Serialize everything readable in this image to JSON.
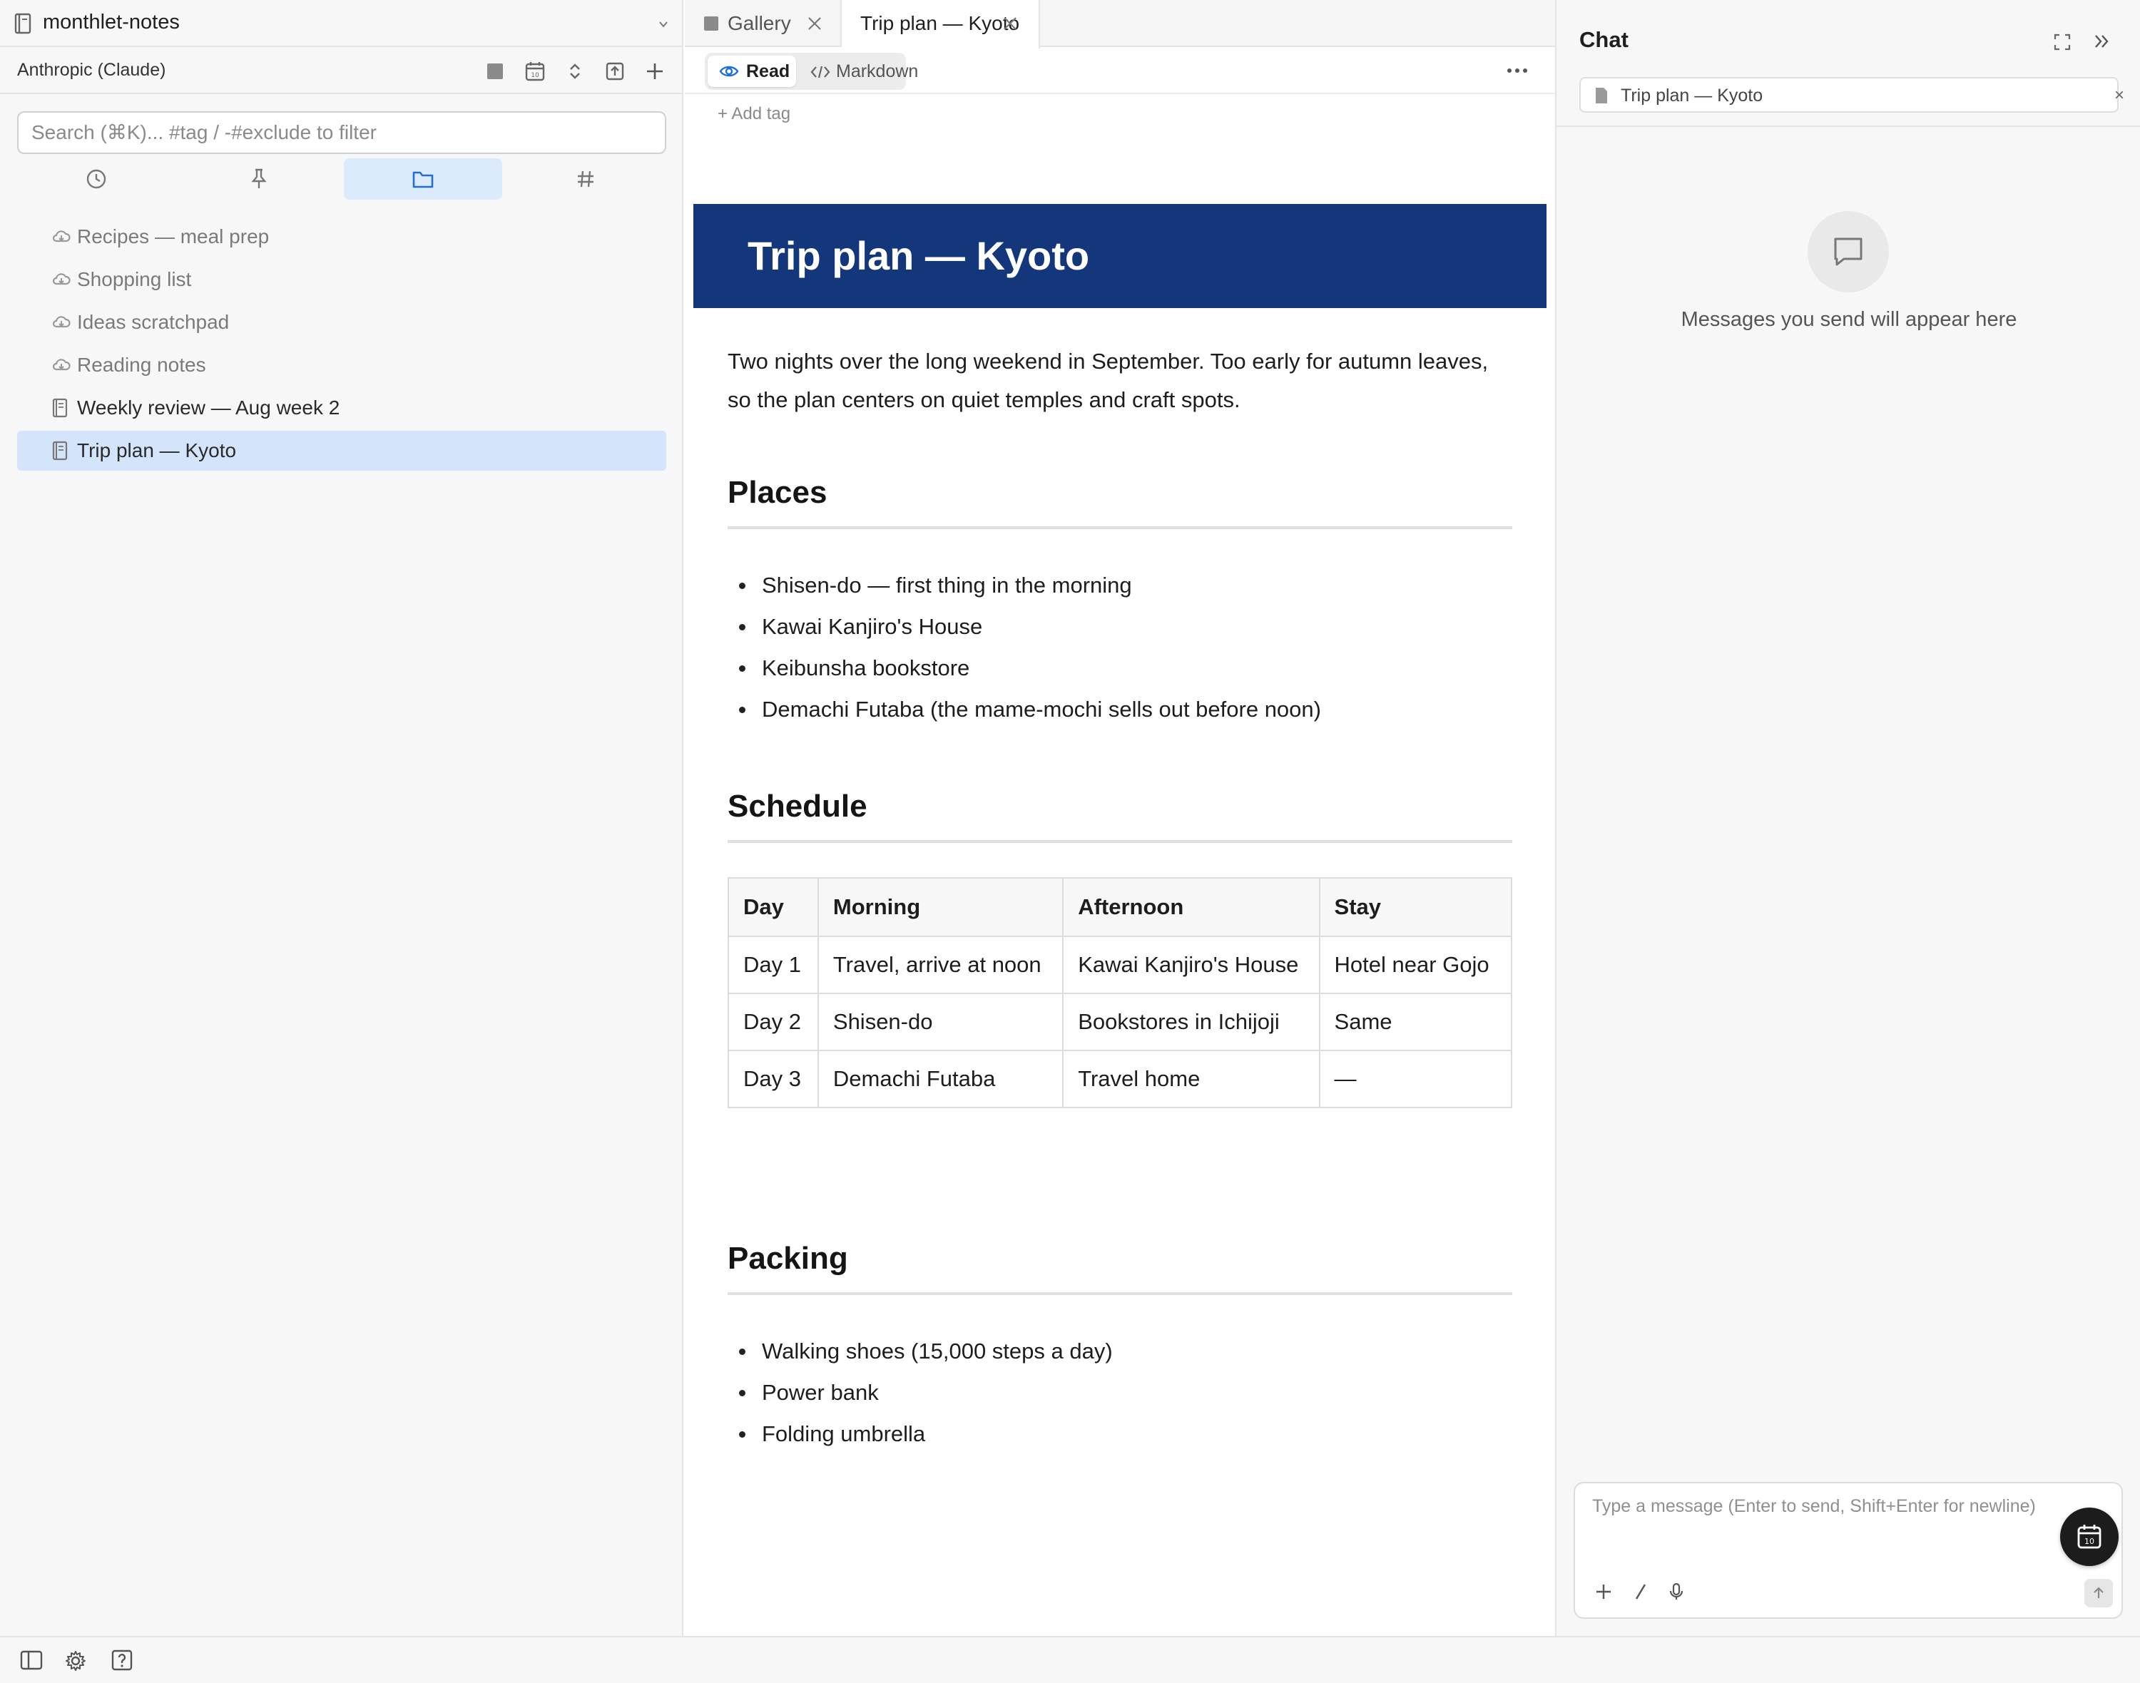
{
  "sidebar": {
    "vault_name": "monthlet-notes",
    "provider": "Anthropic (Claude)",
    "toolbar_icons": [
      "gallery-icon",
      "calendar-icon",
      "sort-icon",
      "export-icon",
      "plus-icon"
    ],
    "search": {
      "placeholder": "Search (⌘K)... #tag / -#exclude to filter",
      "value": ""
    },
    "view_tabs": [
      {
        "icon": "clock-icon",
        "active": false
      },
      {
        "icon": "pin-icon",
        "active": false
      },
      {
        "icon": "folder-icon",
        "active": true
      },
      {
        "icon": "hashtag-icon",
        "active": false
      }
    ],
    "files": [
      {
        "label": "Recipes — meal prep",
        "icon": "cloud-icon",
        "active": false
      },
      {
        "label": "Shopping list",
        "icon": "cloud-icon",
        "active": false
      },
      {
        "label": "Ideas scratchpad",
        "icon": "cloud-icon",
        "active": false
      },
      {
        "label": "Reading notes",
        "icon": "cloud-icon",
        "active": false
      },
      {
        "label": "Weekly review — Aug week 2",
        "icon": "document-icon",
        "active": false
      },
      {
        "label": "Trip plan — Kyoto",
        "icon": "document-icon",
        "active": true
      }
    ]
  },
  "tabs": [
    {
      "label": "Gallery",
      "active": false
    },
    {
      "label": "Trip plan — Kyoto",
      "active": true
    }
  ],
  "modes": {
    "read": "Read",
    "markdown": "Markdown",
    "active": "Read"
  },
  "add_tag": "+ Add tag",
  "doc": {
    "title": "Trip plan — Kyoto",
    "banner_color": "#14377b",
    "intro": "Two nights over the long weekend in September. Too early for autumn leaves, so the plan centers on quiet temples and craft spots.",
    "places_heading": "Places",
    "places": [
      "Shisen-do — first thing in the morning",
      "Kawai Kanjiro's House",
      "Keibunsha bookstore",
      "Demachi Futaba (the mame-mochi sells out before noon)"
    ],
    "schedule_heading": "Schedule",
    "schedule": {
      "headers": [
        "Day",
        "Morning",
        "Afternoon",
        "Stay"
      ],
      "rows": [
        [
          "Day 1",
          "Travel, arrive at noon",
          "Kawai Kanjiro's House",
          "Hotel near Gojo"
        ],
        [
          "Day 2",
          "Shisen-do",
          "Bookstores in Ichijoji",
          "Same"
        ],
        [
          "Day 3",
          "Demachi Futaba",
          "Travel home",
          "—"
        ]
      ]
    },
    "packing_heading": "Packing",
    "packing": [
      "Walking shoes (15,000 steps a day)",
      "Power bank",
      "Folding umbrella"
    ]
  },
  "chat": {
    "title": "Chat",
    "context_chip": "Trip plan — Kyoto",
    "chip_close": "×",
    "empty_message": "Messages you send will appear here",
    "input_placeholder": "Type a message (Enter to send, Shift+Enter for newline)",
    "input_value": ""
  },
  "bottom_icons": [
    "sidebar-toggle-icon",
    "settings-icon",
    "help-icon"
  ]
}
